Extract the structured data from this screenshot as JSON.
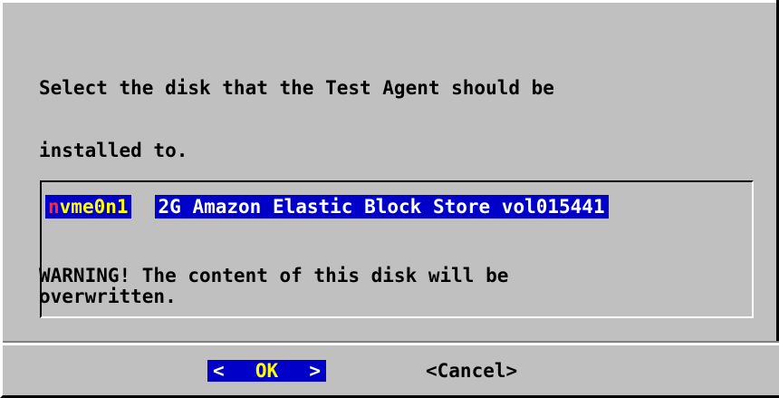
{
  "dialog": {
    "message_lines": [
      "Select the disk that the Test Agent should be",
      "installed to.",
      "WARNING! The content of this disk will be",
      "overwritten."
    ]
  },
  "disk_list": {
    "items": [
      {
        "tag_hotkey": "n",
        "tag_rest": "vme0n1",
        "description": "2G Amazon Elastic Block Store vol015441",
        "selected": true
      }
    ]
  },
  "buttons": {
    "ok": {
      "left_bracket": "<",
      "label": "OK",
      "right_bracket": ">",
      "selected": true
    },
    "cancel": {
      "label": "<Cancel>",
      "selected": false
    }
  },
  "colors": {
    "dialog_background": "#c0c0c0",
    "selection_background": "#0000c8",
    "selection_text": "#ffffff",
    "tag_text": "#ffff00",
    "hotkey_text": "#ff2a2a",
    "highlight_shadow": "#ffffff",
    "dark_shadow": "#000000"
  }
}
